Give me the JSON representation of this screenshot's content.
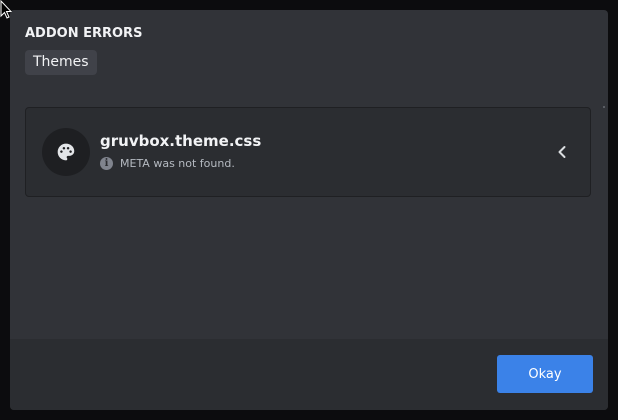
{
  "dialog": {
    "title": "ADDON ERRORS",
    "tabs": [
      {
        "label": "Themes",
        "selected": true
      }
    ]
  },
  "errors": [
    {
      "name": "gruvbox.theme.css",
      "message": "META was not found.",
      "icon": "palette-icon",
      "expand_icon": "chevron-left-icon"
    }
  ],
  "footer": {
    "okay_label": "Okay"
  },
  "colors": {
    "modal_bg": "#313338",
    "card_bg": "#2b2d31",
    "accent": "#3b82e8"
  }
}
